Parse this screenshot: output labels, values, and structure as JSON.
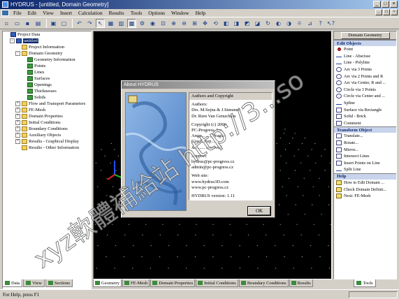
{
  "window": {
    "title": "HYDRUS - [untitled, Domain Geometry]",
    "min": "_",
    "max": "□",
    "close": "×"
  },
  "menu": [
    "File",
    "Edit",
    "View",
    "Insert",
    "Calculation",
    "Results",
    "Tools",
    "Options",
    "Window",
    "Help"
  ],
  "tree": {
    "items": [
      {
        "label": "Project Data",
        "level": 0,
        "icon": "project-icon",
        "expander": ""
      },
      {
        "label": "untitled",
        "level": 1,
        "icon": "check-icon",
        "expander": "-",
        "selected": true
      },
      {
        "label": "Project Information",
        "level": 2,
        "icon": "folder-icon",
        "expander": ""
      },
      {
        "label": "Domain Geometry",
        "level": 2,
        "icon": "folder-icon",
        "expander": "-"
      },
      {
        "label": "Geometry Information",
        "level": 3,
        "icon": "grid-icon",
        "expander": ""
      },
      {
        "label": "Points",
        "level": 3,
        "icon": "grid-icon",
        "expander": ""
      },
      {
        "label": "Lines",
        "level": 3,
        "icon": "grid-icon",
        "expander": ""
      },
      {
        "label": "Surfaces",
        "level": 3,
        "icon": "grid-icon",
        "expander": ""
      },
      {
        "label": "Openings",
        "level": 3,
        "icon": "grid-icon",
        "expander": ""
      },
      {
        "label": "Thicknesses",
        "level": 3,
        "icon": "grid-icon",
        "expander": ""
      },
      {
        "label": "Solids",
        "level": 3,
        "icon": "grid-icon",
        "expander": ""
      },
      {
        "label": "Flow and Transport Parameters",
        "level": 2,
        "icon": "folder-icon",
        "expander": "+"
      },
      {
        "label": "FE-Mesh",
        "level": 2,
        "icon": "folder-icon",
        "expander": "+"
      },
      {
        "label": "Domain Properties",
        "level": 2,
        "icon": "folder-icon",
        "expander": "+"
      },
      {
        "label": "Initial Conditions",
        "level": 2,
        "icon": "folder-icon",
        "expander": "+"
      },
      {
        "label": "Boundary Conditions",
        "level": 2,
        "icon": "folder-icon",
        "expander": "+"
      },
      {
        "label": "Auxiliary Objects",
        "level": 2,
        "icon": "folder-icon",
        "expander": "+"
      },
      {
        "label": "Results - Graphical Display",
        "level": 2,
        "icon": "folder-icon",
        "expander": "+"
      },
      {
        "label": "Results - Other Information",
        "level": 2,
        "icon": "folder-icon",
        "expander": ""
      }
    ]
  },
  "left_tabs": [
    "Data",
    "View",
    "Sections"
  ],
  "view_tabs": [
    "Geometry",
    "FE-Mesh",
    "Domain Properties",
    "Initial Conditions",
    "Boundary Conditions",
    "Results"
  ],
  "right_tabs": [
    "Tools"
  ],
  "right_panel": {
    "top_button": "Domain Geometry",
    "sections": [
      {
        "title": "Edit Objects",
        "items": [
          "Point",
          "Line - Abscisse",
          "Line - Polyline",
          "Arc via 3 Points",
          "Arc via 2 Points and R",
          "Arc via Center, R and ...",
          "Circle via 3 Points",
          "Circle via Center and ...",
          "Spline",
          "Surface via Rectangle",
          "Solid - Brick",
          "Comment"
        ]
      },
      {
        "title": "Transform Object",
        "items": [
          "Translate...",
          "Rotate...",
          "Mirror...",
          "Intersect Lines",
          "Insert Points on Line",
          "Split Line"
        ]
      },
      {
        "title": "Help",
        "items": [
          "How to Edit Domain ...",
          "Check Domain Definit...",
          "Next: FE-Mesh"
        ]
      }
    ]
  },
  "status": "For Help, press F1",
  "dialog": {
    "title": "About HYDRUS",
    "section_header": "Authors and Copyright",
    "lines": [
      "Authors:",
      "Drs. M.Sejna & J.Simunek",
      "Dr. Rien Van Genuchten",
      "",
      "Copyright (c) 2006",
      "PC-Progress, Inc.",
      "Ange... ...., Prague",
      "Czech Rep... ...",
      "All ...... reserved",
      "",
      "Support:",
      "hydrus@pc-progress.cz",
      "admin@pc-progress.cz",
      "",
      "Web site:",
      "www.hydrus3D.com",
      "www.pc-progress.cz",
      "",
      "HYDRUS version: 1.11"
    ],
    "ok": "OK"
  },
  "watermark": {
    "text": "xyz軟體補給站 http://3...so"
  }
}
